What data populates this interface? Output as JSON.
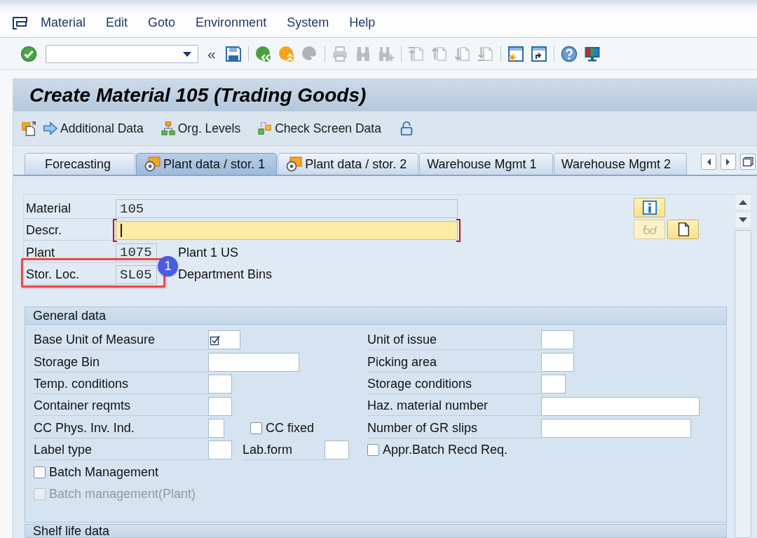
{
  "menu_bar": {
    "items": [
      {
        "label": "Material"
      },
      {
        "label": "Edit"
      },
      {
        "label": "Goto"
      },
      {
        "label": "Environment"
      },
      {
        "label": "System"
      },
      {
        "label": "Help"
      }
    ]
  },
  "toolbar": {
    "groups": [
      [
        {
          "kind": "enter",
          "disabled": false
        },
        {
          "kind": "command",
          "disabled": false
        },
        {
          "kind": "collapse",
          "label": "«",
          "disabled": false
        },
        {
          "kind": "save",
          "disabled": false
        }
      ],
      [
        {
          "kind": "back",
          "disabled": false
        },
        {
          "kind": "exit",
          "disabled": false
        },
        {
          "kind": "cancel",
          "disabled": true
        }
      ],
      [
        {
          "kind": "print",
          "disabled": true
        },
        {
          "kind": "find",
          "disabled": true
        },
        {
          "kind": "findnext",
          "disabled": true
        }
      ],
      [
        {
          "kind": "first",
          "disabled": true
        },
        {
          "kind": "previous",
          "disabled": true
        },
        {
          "kind": "next",
          "disabled": true
        },
        {
          "kind": "last",
          "disabled": true
        }
      ],
      [
        {
          "kind": "session",
          "disabled": false
        },
        {
          "kind": "shortcut",
          "disabled": false
        }
      ],
      [
        {
          "kind": "help",
          "disabled": false
        },
        {
          "kind": "layout",
          "disabled": false
        }
      ]
    ]
  },
  "title": "Create Material 105 (Trading Goods)",
  "app_toolbar": {
    "items": [
      {
        "kind": "views"
      },
      {
        "kind": "additional",
        "label": "Additional Data"
      },
      {
        "kind": "org",
        "label": "Org. Levels"
      },
      {
        "kind": "check",
        "label": "Check Screen Data"
      },
      {
        "kind": "lock"
      }
    ]
  },
  "tabs": {
    "items": [
      {
        "label": "Forecasting",
        "selected": false,
        "kind": "plain"
      },
      {
        "label": "Plant data / stor. 1",
        "selected": true,
        "kind": "org"
      },
      {
        "label": "Plant data / stor. 2",
        "selected": false,
        "kind": "org"
      },
      {
        "label": "Warehouse Mgmt 1",
        "selected": false,
        "kind": "plain"
      },
      {
        "label": "Warehouse Mgmt 2",
        "selected": false,
        "kind": "plain"
      }
    ]
  },
  "header": {
    "fields": [
      {
        "label": "Material",
        "kind": "long",
        "value": "105",
        "editable": false,
        "required": false,
        "focused": false,
        "highlighted": false
      },
      {
        "label": "Descr.",
        "kind": "long",
        "editable": true,
        "required": true,
        "focused": true,
        "highlighted": false
      },
      {
        "label": "Plant",
        "kind": "short",
        "value": "1075",
        "description": "Plant 1 US",
        "editable": false,
        "required": false,
        "focused": false,
        "highlighted": false
      },
      {
        "label": "Stor. Loc.",
        "kind": "short",
        "value": "SL05",
        "description": "Department Bins",
        "editable": false,
        "required": false,
        "focused": false,
        "highlighted": true,
        "callout": "1"
      }
    ]
  },
  "side_buttons": [
    [
      {
        "kind": "info",
        "disabled": false
      }
    ],
    [
      {
        "kind": "display",
        "disabled": true
      },
      {
        "kind": "create",
        "disabled": false
      }
    ]
  ],
  "general_data": {
    "title": "General data",
    "rows": [
      {
        "left": [
          {
            "kind": "field",
            "label": "Base Unit of Measure",
            "required": true
          }
        ],
        "right": [
          {
            "kind": "field",
            "label": "Unit of issue",
            "required": false
          }
        ]
      },
      {
        "left": [
          {
            "kind": "field",
            "label": "Storage Bin",
            "required": false
          }
        ],
        "right": [
          {
            "kind": "field",
            "label": "Picking area",
            "required": false
          }
        ]
      },
      {
        "left": [
          {
            "kind": "field",
            "label": "Temp. conditions",
            "required": false
          }
        ],
        "right": [
          {
            "kind": "field",
            "label": "Storage conditions",
            "required": false
          }
        ]
      },
      {
        "left": [
          {
            "kind": "field",
            "label": "Container reqmts",
            "required": false
          }
        ],
        "right": [
          {
            "kind": "field",
            "label": "Haz. material number",
            "required": false
          }
        ]
      },
      {
        "left": [
          {
            "kind": "field",
            "label": "CC Phys. Inv. Ind.",
            "required": false
          },
          {
            "kind": "checkbox",
            "label": "CC fixed",
            "checked": false,
            "disabled": false
          }
        ],
        "right": [
          {
            "kind": "field",
            "label": "Number of GR slips",
            "required": false
          }
        ]
      },
      {
        "left": [
          {
            "kind": "field",
            "label": "Label type",
            "required": false
          },
          {
            "kind": "field",
            "label": "Lab.form",
            "required": false
          }
        ],
        "right": [
          {
            "kind": "checkbox",
            "label": "Appr.Batch Recd Req.",
            "checked": false,
            "disabled": false
          }
        ]
      },
      {
        "left": [
          {
            "kind": "checkbox",
            "label": "Batch Management",
            "checked": false,
            "disabled": false
          }
        ]
      },
      {
        "left": [
          {
            "kind": "checkbox",
            "label": "Batch management(Plant)",
            "checked": false,
            "disabled": true
          }
        ]
      }
    ]
  },
  "shelf_life_data": {
    "title": "Shelf life data"
  }
}
